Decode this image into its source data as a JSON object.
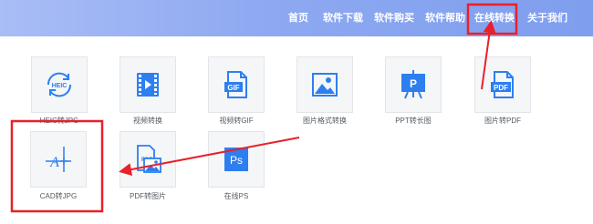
{
  "nav": {
    "items": [
      "首页",
      "软件下载",
      "软件购买",
      "软件帮助",
      "在线转换",
      "关于我们"
    ]
  },
  "tools": [
    {
      "label": "HEIC转JPG",
      "icon": "heic-icon"
    },
    {
      "label": "视频转换",
      "icon": "video-icon"
    },
    {
      "label": "视频转GIF",
      "icon": "gif-file-icon"
    },
    {
      "label": "图片格式转换",
      "icon": "image-icon"
    },
    {
      "label": "PPT转长图",
      "icon": "presentation-icon"
    },
    {
      "label": "图片转PDF",
      "icon": "pdf-file-icon"
    },
    {
      "label": "CAD转JPG",
      "icon": "cad-icon"
    },
    {
      "label": "PDF转图片",
      "icon": "pdf-image-icon"
    },
    {
      "label": "在线PS",
      "icon": "photoshop-icon"
    }
  ],
  "icon_text": {
    "heic": "HEIC",
    "gif": "GIF",
    "ppt": "P",
    "pdf": "PDF",
    "cad": "A",
    "ps": "Ps"
  },
  "colors": {
    "accent": "#2d7ff0",
    "annotation": "#e8202a",
    "nav_bg": "#8ea9f1"
  }
}
